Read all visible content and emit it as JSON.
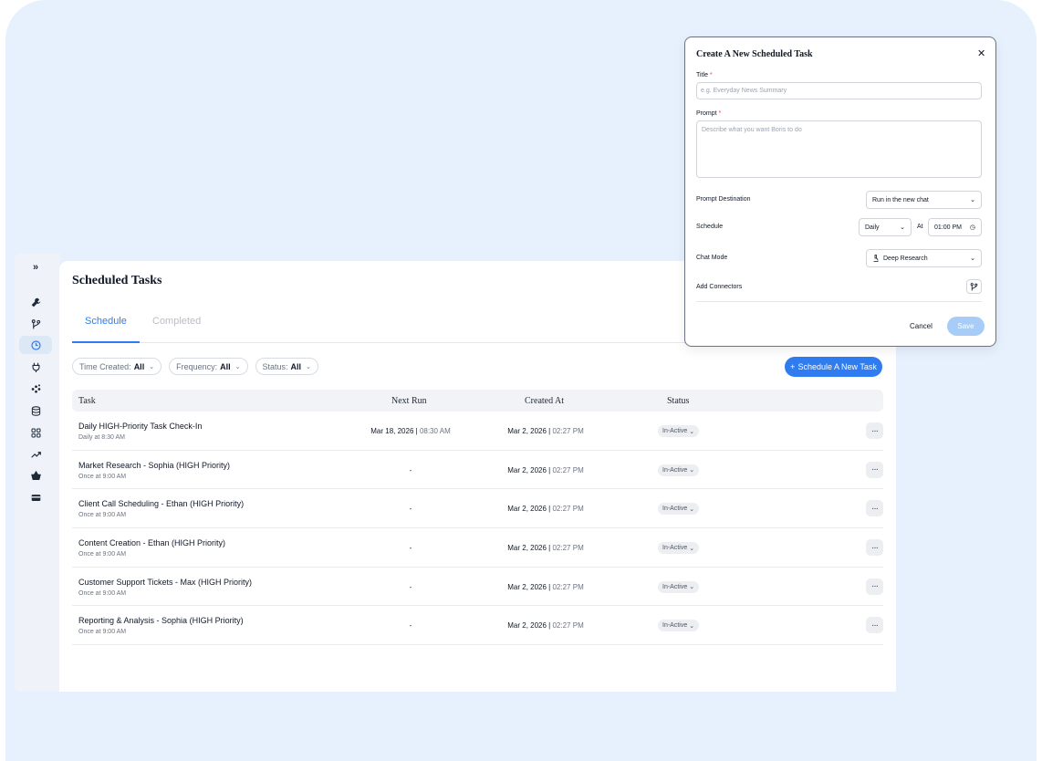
{
  "page": {
    "title": "Scheduled Tasks"
  },
  "sidebar": {
    "expand_icon": "double-chevron-right-icon",
    "items": [
      {
        "icon": "wrench-icon",
        "active": false
      },
      {
        "icon": "git-branch-icon",
        "active": false
      },
      {
        "icon": "clock-icon",
        "active": true
      },
      {
        "icon": "plug-icon",
        "active": false
      },
      {
        "icon": "nodes-icon",
        "active": false
      },
      {
        "icon": "database-icon",
        "active": false
      },
      {
        "icon": "grid-apps-icon",
        "active": false
      },
      {
        "icon": "trend-up-icon",
        "active": false
      },
      {
        "icon": "basket-icon",
        "active": false
      },
      {
        "icon": "card-icon",
        "active": false
      }
    ]
  },
  "tabs": [
    {
      "label": "Schedule",
      "active": true
    },
    {
      "label": "Completed",
      "active": false
    }
  ],
  "filters": [
    {
      "label": "Time Created:",
      "value": "All"
    },
    {
      "label": "Frequency:",
      "value": "All"
    },
    {
      "label": "Status:",
      "value": "All"
    }
  ],
  "add_button": {
    "label": "Schedule A New Task"
  },
  "table": {
    "headers": {
      "task": "Task",
      "next_run": "Next Run",
      "created_at": "Created At",
      "status": "Status"
    },
    "rows": [
      {
        "name": "Daily HIGH-Priority Task Check-In",
        "sub": "Daily at 8:30 AM",
        "next_date": "Mar 18, 2026 |",
        "next_time": "08:30 AM",
        "created_date": "Mar 2, 2026 |",
        "created_time": "02:27 PM",
        "status": "In-Active"
      },
      {
        "name": "Market Research - Sophia (HIGH Priority)",
        "sub": "Once at 9:00 AM",
        "next_date": "-",
        "next_time": "",
        "created_date": "Mar 2, 2026 |",
        "created_time": "02:27 PM",
        "status": "In-Active"
      },
      {
        "name": "Client Call Scheduling - Ethan (HIGH Priority)",
        "sub": "Once at 9:00 AM",
        "next_date": "-",
        "next_time": "",
        "created_date": "Mar 2, 2026 |",
        "created_time": "02:27 PM",
        "status": "In-Active"
      },
      {
        "name": "Content Creation - Ethan (HIGH Priority)",
        "sub": "Once at 9:00 AM",
        "next_date": "-",
        "next_time": "",
        "created_date": "Mar 2, 2026 |",
        "created_time": "02:27 PM",
        "status": "In-Active"
      },
      {
        "name": "Customer Support Tickets - Max (HIGH Priority)",
        "sub": "Once at 9:00 AM",
        "next_date": "-",
        "next_time": "",
        "created_date": "Mar 2, 2026 |",
        "created_time": "02:27 PM",
        "status": "In-Active"
      },
      {
        "name": "Reporting & Analysis - Sophia (HIGH Priority)",
        "sub": "Once at 9:00 AM",
        "next_date": "-",
        "next_time": "",
        "created_date": "Mar 2, 2026 |",
        "created_time": "02:27 PM",
        "status": "In-Active"
      }
    ]
  },
  "modal": {
    "title": "Create A New Scheduled Task",
    "title_label": "Title",
    "title_placeholder": "e.g. Everyday News Summary",
    "prompt_label": "Prompt",
    "prompt_placeholder": "Describe what you want Boris to do",
    "required_mark": "*",
    "destination_label": "Prompt Destination",
    "destination_value": "Run in the new chat",
    "schedule_label": "Schedule",
    "schedule_value": "Daily",
    "at_label": "At",
    "time_value": "01:00 PM",
    "chat_mode_label": "Chat Mode",
    "chat_mode_value": "Deep Research",
    "connectors_label": "Add Connectors",
    "cancel_label": "Cancel",
    "save_label": "Save"
  },
  "colors": {
    "accent": "#2f7cf0",
    "background": "#e6f1fd",
    "save_disabled": "#a8ccf8"
  }
}
